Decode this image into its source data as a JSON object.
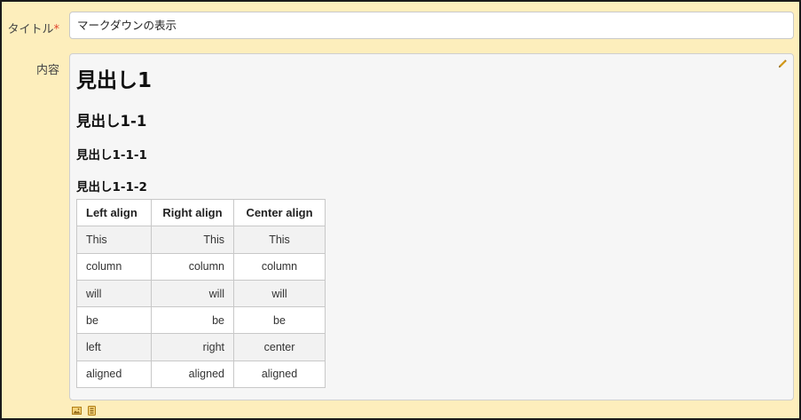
{
  "form": {
    "title_label": "タイトル",
    "required_mark": "*",
    "title_value": "マークダウンの表示",
    "content_label": "内容"
  },
  "content": {
    "h1": "見出し1",
    "h2": "見出し1-1",
    "h3": "見出し1-1-1",
    "h4": "見出し1-1-2",
    "table": {
      "headers": [
        "Left align",
        "Right align",
        "Center align"
      ],
      "rows": [
        [
          "This",
          "This",
          "This"
        ],
        [
          "column",
          "column",
          "column"
        ],
        [
          "will",
          "will",
          "will"
        ],
        [
          "be",
          "be",
          "be"
        ],
        [
          "left",
          "right",
          "center"
        ],
        [
          "aligned",
          "aligned",
          "aligned"
        ]
      ]
    }
  },
  "icons": {
    "edit": "pencil-icon",
    "toolbar": [
      "image-icon",
      "attachment-icon"
    ]
  },
  "colors": {
    "background": "#fdeebc",
    "required": "#e0442c",
    "icon_accent": "#d49a1a"
  }
}
